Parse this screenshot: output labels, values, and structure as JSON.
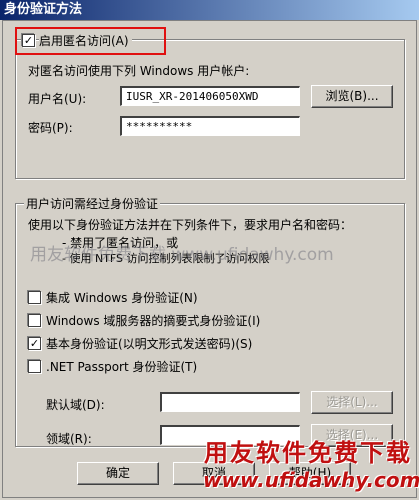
{
  "window": {
    "title": "身份验证方法"
  },
  "anonymous": {
    "checkbox_label": "启用匿名访问(A)",
    "checked": true,
    "description": "对匿名访问使用下列 Windows 用户帐户:",
    "username_label": "用户名(U):",
    "username_value": "IUSR_XR-201406050XWD",
    "browse_label": "浏览(B)...",
    "password_label": "密码(P):",
    "password_value": "**********"
  },
  "auth": {
    "group_title": "用户访问需经过身份验证",
    "description": "使用以下身份验证方法并在下列条件下，要求用户名和密码：",
    "cond1": "- 禁用了匿名访问，或",
    "cond2": "- 使用 NTFS 访问控制列表限制了访问权限",
    "methods": [
      {
        "label": "集成 Windows 身份验证(N)",
        "checked": false
      },
      {
        "label": "Windows 域服务器的摘要式身份验证(I)",
        "checked": false
      },
      {
        "label": "基本身份验证(以明文形式发送密码)(S)",
        "checked": true
      },
      {
        "label": ".NET Passport 身份验证(T)",
        "checked": false
      }
    ],
    "default_domain_label": "默认域(D):",
    "default_domain_select": "选择(L)...",
    "realm_label": "领域(R):",
    "realm_select": "选择(E)..."
  },
  "buttons": {
    "ok": "确定",
    "cancel": "取消",
    "help": "帮助(H)"
  },
  "watermark": {
    "overlay": "用友软件免费下载 www.ufidawhy.com",
    "brand_cn": "用友软件免费下载",
    "brand_url": "www.ufidawhy.com"
  },
  "colors": {
    "highlight": "#e01010",
    "titlebar": "#0a246a",
    "brand": "#c01010"
  }
}
